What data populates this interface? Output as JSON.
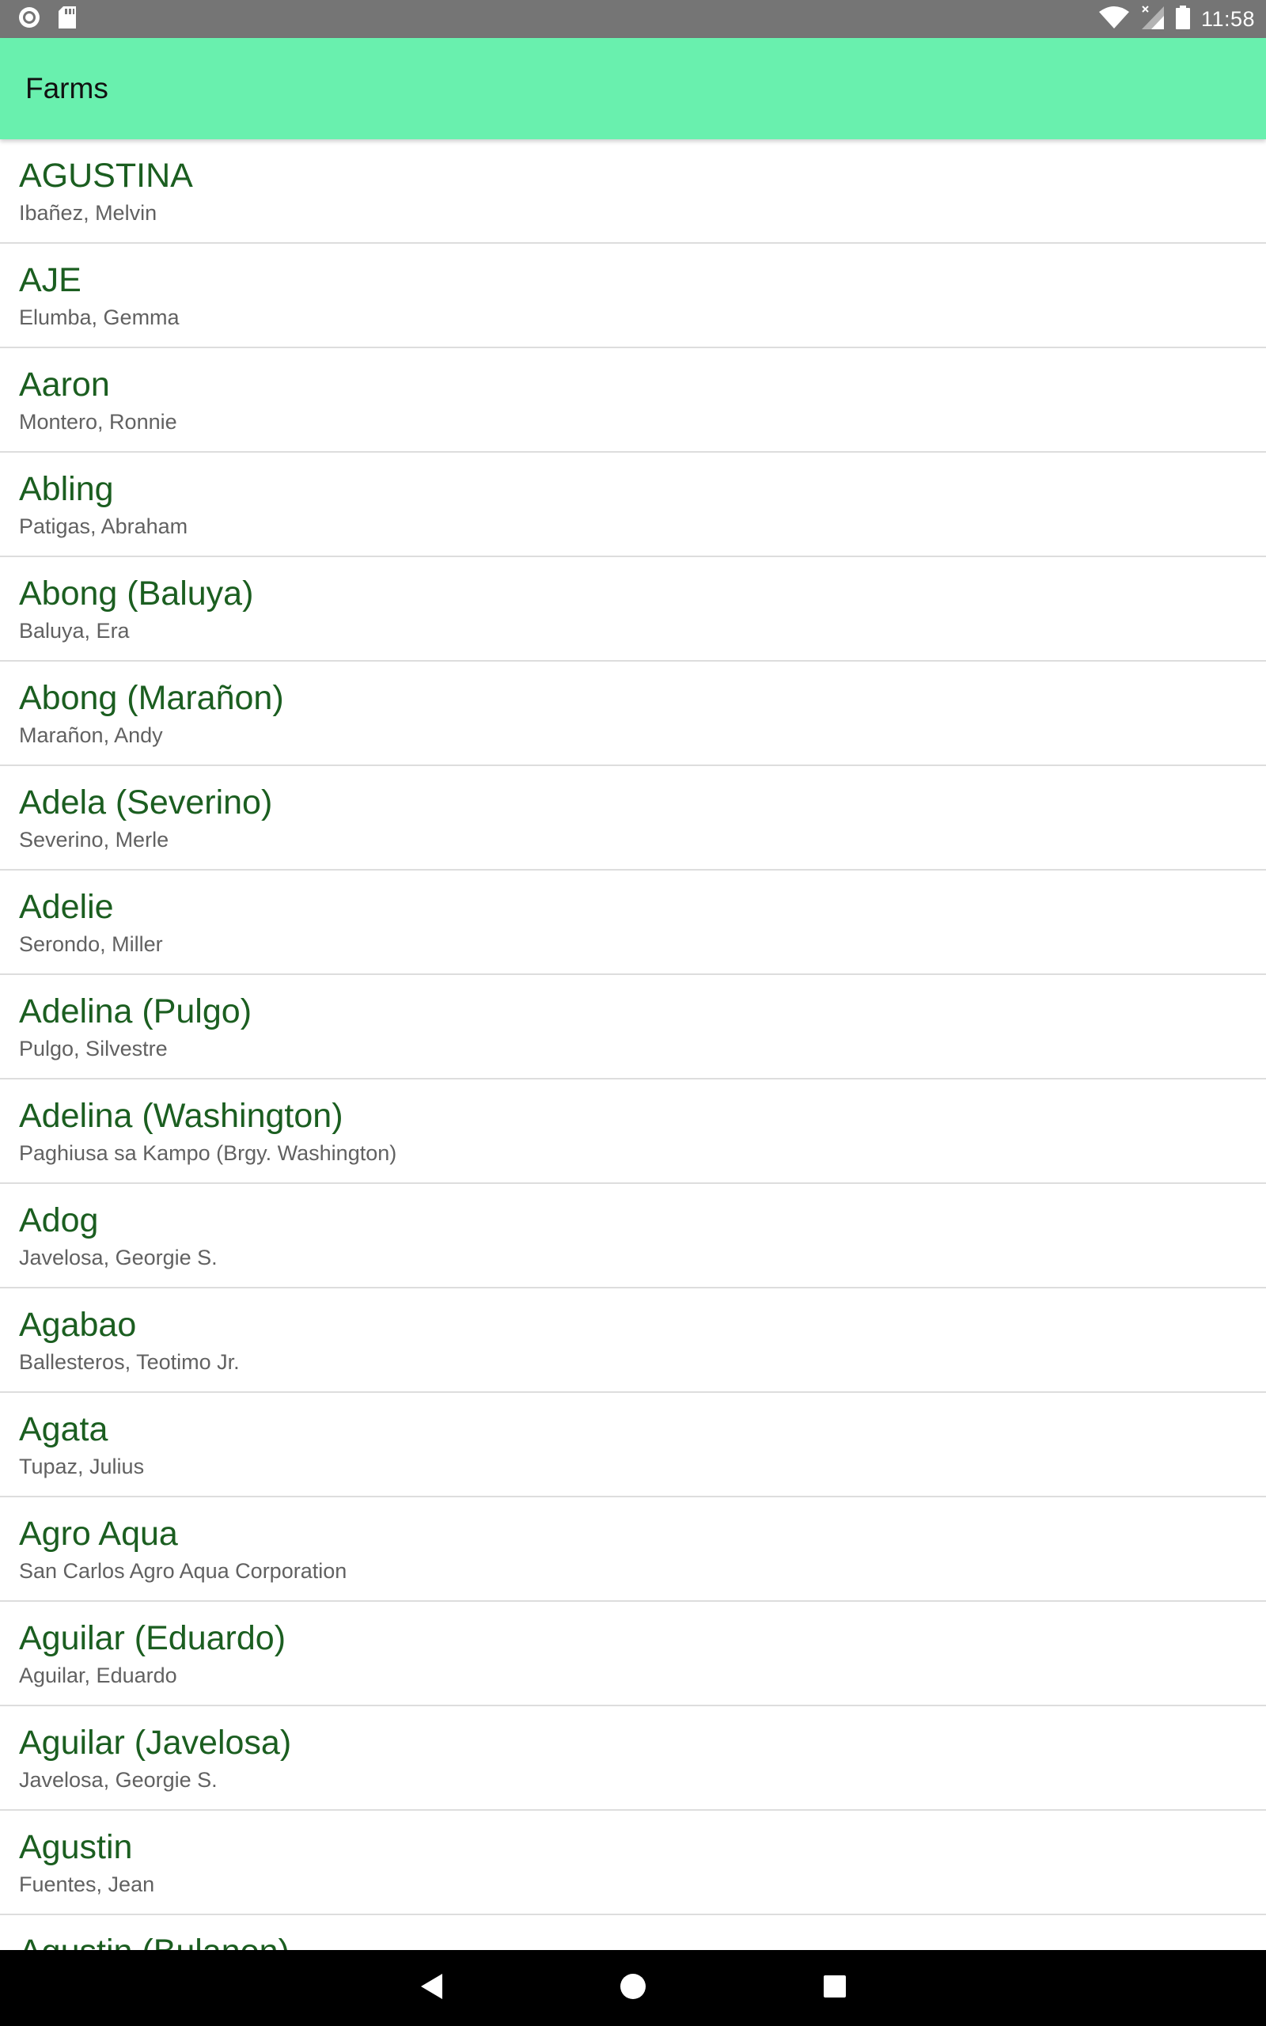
{
  "status_bar": {
    "time": "11:58",
    "icons_left": [
      "circle-notification-icon",
      "sd-card-icon"
    ],
    "icons_right": [
      "wifi-icon",
      "signal-icon",
      "battery-icon"
    ]
  },
  "app_bar": {
    "title": "Farms",
    "color": "#69f0ae"
  },
  "farms": [
    {
      "name": "AGUSTINA",
      "owner": "Ibañez, Melvin"
    },
    {
      "name": "AJE",
      "owner": "Elumba, Gemma"
    },
    {
      "name": "Aaron",
      "owner": "Montero, Ronnie"
    },
    {
      "name": "Abling",
      "owner": "Patigas, Abraham"
    },
    {
      "name": "Abong (Baluya)",
      "owner": "Baluya, Era"
    },
    {
      "name": "Abong (Marañon)",
      "owner": "Marañon, Andy"
    },
    {
      "name": "Adela (Severino)",
      "owner": "Severino, Merle"
    },
    {
      "name": "Adelie",
      "owner": "Serondo, Miller"
    },
    {
      "name": "Adelina (Pulgo)",
      "owner": "Pulgo, Silvestre"
    },
    {
      "name": "Adelina (Washington)",
      "owner": "Paghiusa sa Kampo (Brgy. Washington)"
    },
    {
      "name": "Adog",
      "owner": "Javelosa, Georgie S."
    },
    {
      "name": "Agabao",
      "owner": "Ballesteros, Teotimo Jr."
    },
    {
      "name": "Agata",
      "owner": "Tupaz, Julius"
    },
    {
      "name": "Agro Aqua",
      "owner": "San Carlos Agro Aqua Corporation"
    },
    {
      "name": "Aguilar (Eduardo)",
      "owner": "Aguilar, Eduardo"
    },
    {
      "name": "Aguilar (Javelosa)",
      "owner": "Javelosa, Georgie S."
    },
    {
      "name": "Agustin",
      "owner": "Fuentes, Jean"
    },
    {
      "name": "Agustin (Bulanon)",
      "owner": ""
    }
  ],
  "nav_bar": {
    "icons": [
      "back-icon",
      "home-icon",
      "recents-icon"
    ]
  }
}
